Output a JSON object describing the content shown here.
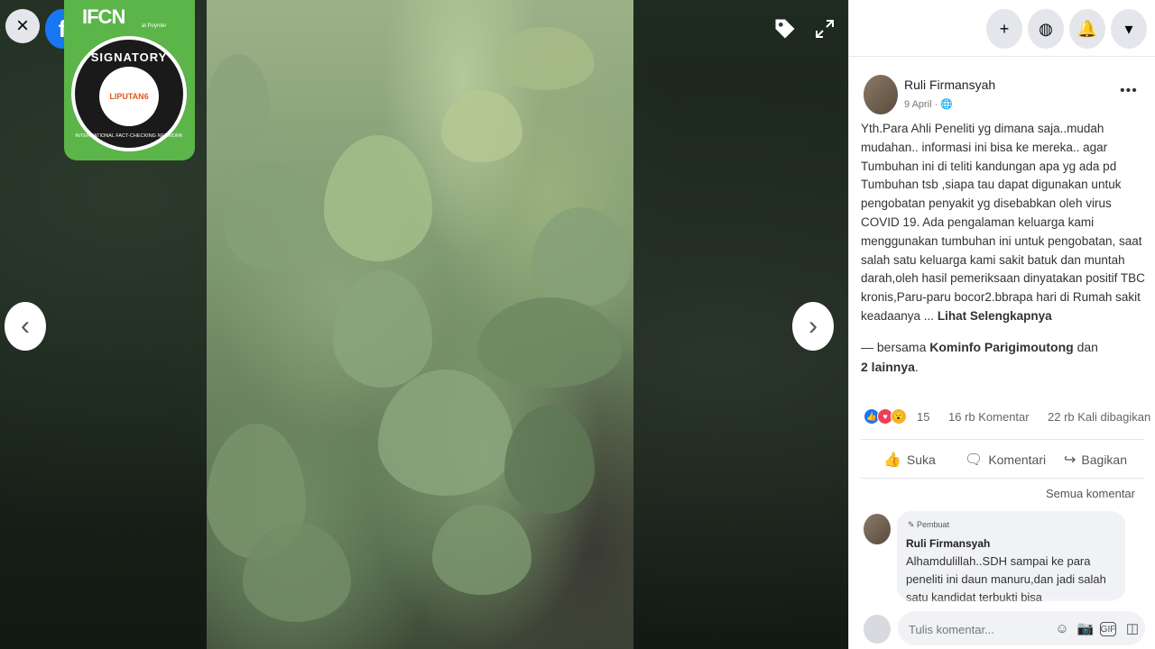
{
  "viewer": {
    "close_icon": "×",
    "fb_logo": "f",
    "tag_icon": "tag-icon",
    "expand_icon": "expand-icon",
    "prev_arrow": "‹",
    "next_arrow": "›"
  },
  "ifcn": {
    "logo": "IFCN",
    "sub": "at Poynter",
    "signatory": "SIGNATORY",
    "network": "INTERNATIONAL FACT-CHECKING NETWORK",
    "partner": "LIPUTAN6"
  },
  "header": {
    "plus_icon": "+",
    "messenger_icon": "◍",
    "bell_icon": "🔔",
    "dropdown_icon": "▾"
  },
  "post": {
    "author": "Ruli Firmansyah",
    "date": "9 April · 🌐",
    "more_icon": "•••",
    "text": "Yth.Para Ahli Peneliti yg dimana saja..mudah mudahan.. informasi ini bisa ke mereka.. agar Tumbuhan ini di teliti kandungan apa yg ada pd Tumbuhan tsb ,siapa tau dapat digunakan untuk pengobatan penyakit yg disebabkan oleh virus COVID 19. Ada pengalaman keluarga kami menggunakan tumbuhan ini untuk pengobatan, saat salah satu keluarga kami sakit batuk dan muntah darah,oleh hasil pemeriksaan dinyatakan positif TBC kronis,Paru-paru bocor2.bbrapa hari di Rumah sakit keadaanya ...",
    "see_more": "Lihat Selengkapnya",
    "with_prefix": "— bersama",
    "with_page": "Kominfo Parigimoutong",
    "with_and": "dan",
    "with_others": "2 lainnya",
    "with_end": "."
  },
  "stats": {
    "reactions": "15",
    "comments": "16 rb Komentar",
    "shares": "22 rb Kali dibagikan"
  },
  "actions": {
    "like": "Suka",
    "comment": "Komentari",
    "share": "Bagikan"
  },
  "comments": {
    "all_label": "Semua komentar",
    "items": [
      {
        "badge": "✎ Pembuat",
        "author": "Ruli Firmansyah",
        "text": "Alhamdulillah..SDH sampai ke para peneliti ini daun manuru,dan jadi salah satu kandidat terbukti bisa"
      }
    ]
  },
  "composer": {
    "placeholder": "Tulis komentar..."
  },
  "colors": {
    "fb_blue": "#1877f2",
    "ifcn_green": "#5bb548",
    "love": "#f33e58",
    "wow": "#f7b125"
  }
}
